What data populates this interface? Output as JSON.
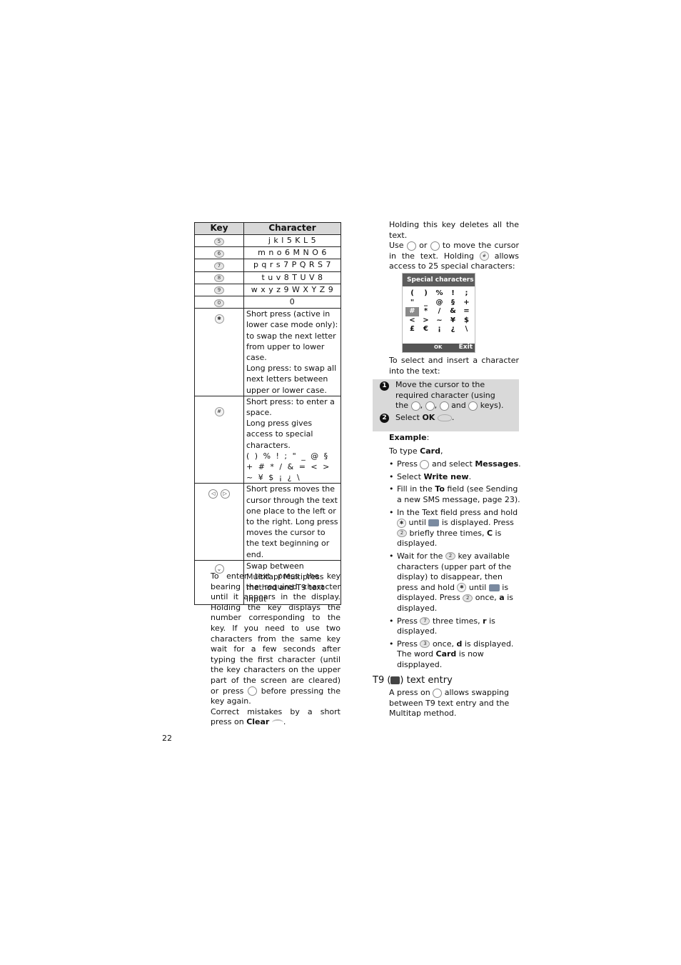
{
  "table": {
    "headers": {
      "key": "Key",
      "character": "Character"
    },
    "char_rows": [
      {
        "key": "5",
        "chars": "j k l 5 K L 5"
      },
      {
        "key": "6",
        "chars": "m n o 6 M N O 6"
      },
      {
        "key": "7",
        "chars": "p q r s 7 P Q R S 7"
      },
      {
        "key": "8",
        "chars": "t u v 8 T U V 8"
      },
      {
        "key": "9",
        "chars": "w x y z 9 W X Y Z 9"
      },
      {
        "key": "0",
        "chars": "0"
      }
    ],
    "star_key": "✱",
    "star_desc": [
      "Short press (active in lower case mode only): to swap the next letter from upper to lower case.",
      "Long press: to swap all next letters between upper or lower case."
    ],
    "hash_key": "#",
    "hash_desc": [
      "Short press: to enter a space.",
      "Long press gives access to special characters.",
      "( ) % ! ; \" _ @ § + # * / & = < > ~ ¥ $ ¡ ¿ \\"
    ],
    "nav_keys": [
      "◁",
      "▷"
    ],
    "nav_desc": "Short press moves the cursor through the text one place to the left or to the right. Long press moves the cursor to the text beginning or end.",
    "t9_key": "⌄",
    "t9_desc": "Swap between Multitap/ Multipress method and T9 text input"
  },
  "left_text": {
    "para1": "To enter text press the key bearing the required character until it appears in the display. Holding the key displays the number corresponding to the key. If you need to use two characters from the same key wait for a few seconds after typing the first character (until the key characters on the upper part of the screen are cleared) or press",
    "para1_end": "before pressing the key again.",
    "para2_start": "Correct mistakes by a short press on",
    "para2_bold": "Clear",
    "para2_end": "."
  },
  "right_text": {
    "holding": "Holding this key deletes all the text.",
    "use_pre": "Use",
    "use_or": "or",
    "use_mid": "to move the cursor in the text. Holding",
    "use_end": "allows access to 25 special characters:",
    "select_insert": "To select and insert a character into the text:",
    "steps": {
      "one_num": "1",
      "one_text": "Move the cursor to the required character (using the",
      "one_and": "and",
      "one_end": "keys).",
      "two_num": "2",
      "two_pre": "Select",
      "two_bold": "OK",
      "two_end": "."
    },
    "example_label": "Example",
    "example_colon": ":",
    "type_pre": "To type",
    "type_bold": "Card",
    "type_end": ",",
    "bullets": {
      "b1_pre": "Press",
      "b1_mid": "and select",
      "b1_bold": "Messages",
      "b1_end": ".",
      "b2_pre": "Select",
      "b2_bold": "Write new",
      "b2_end": ".",
      "b3_pre": "Fill in the",
      "b3_bold": "To",
      "b3_end": "field (see Sending a new SMS message, page 23).",
      "b4_pre": "In the Text field press and hold",
      "b4_until": "until",
      "b4_mid": "is displayed. Press",
      "b4_mid2": "briefly three times,",
      "b4_bold": "C",
      "b4_end": "is displayed.",
      "b5_pre": "Wait for the",
      "b5_mid": "key available characters (upper part of the display) to disappear, then press and hold",
      "b5_until": "until",
      "b5_is": "is displayed. Press",
      "b5_once": "once,",
      "b5_bold": "a",
      "b5_end": "is displayed.",
      "b6_pre": "Press",
      "b6_mid": "three times,",
      "b6_bold": "r",
      "b6_end": "is displayed.",
      "b7_pre": "Press",
      "b7_mid": "once,",
      "b7_bold": "d",
      "b7_end": "is displayed. The word",
      "b7_bold2": "Card",
      "b7_end2": "is now dispplayed."
    },
    "t9_heading_pre": "T9 (",
    "t9_heading_post": ") text entry",
    "t9_para_pre": "A press on",
    "t9_para_end": "allows swapping between T9 text entry and the Multitap method."
  },
  "lcd": {
    "title": "Special characters",
    "chars": [
      "(",
      ")",
      "%",
      "!",
      ";",
      "\"",
      "_",
      "@",
      "§",
      "+",
      "#",
      "*",
      "/",
      "&",
      "=",
      "<",
      ">",
      "~",
      "¥",
      "$",
      "£",
      "€",
      "¡",
      "¿",
      "\\"
    ],
    "selected_index": 10,
    "ok_label": "OK",
    "exit_label": "Exit"
  },
  "page_number": "22"
}
